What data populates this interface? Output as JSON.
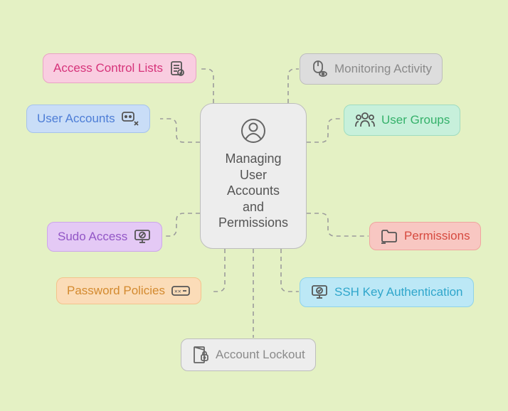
{
  "center": {
    "title_l1": "Managing",
    "title_l2": "User",
    "title_l3": "Accounts",
    "title_l4": "and",
    "title_l5": "Permissions"
  },
  "nodes": {
    "acl": {
      "label": "Access Control Lists"
    },
    "mon": {
      "label": "Monitoring Activity"
    },
    "ua": {
      "label": "User Accounts"
    },
    "ug": {
      "label": "User Groups"
    },
    "sudo": {
      "label": "Sudo Access"
    },
    "perm": {
      "label": "Permissions"
    },
    "pw": {
      "label": "Password Policies"
    },
    "ssh": {
      "label": "SSH Key Authentication"
    },
    "lock": {
      "label": "Account Lockout"
    }
  }
}
